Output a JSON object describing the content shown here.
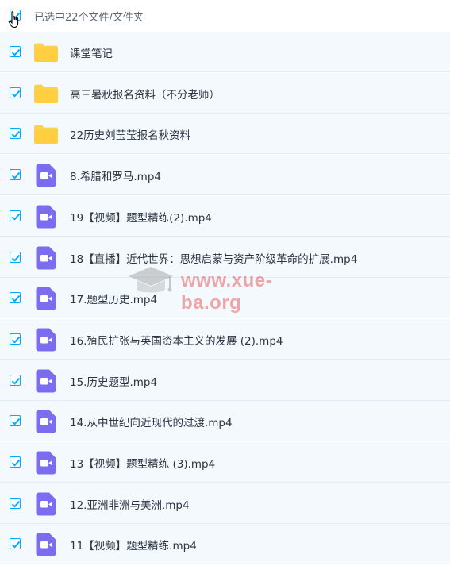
{
  "header": {
    "selection_text": "已选中22个文件/文件夹"
  },
  "files": [
    {
      "name": "课堂笔记",
      "type": "folder"
    },
    {
      "name": "高三暑秋报名资料（不分老师）",
      "type": "folder"
    },
    {
      "name": "22历史刘莹莹报名秋资料",
      "type": "folder"
    },
    {
      "name": "8.希腊和罗马.mp4",
      "type": "video"
    },
    {
      "name": "19【视频】题型精练(2).mp4",
      "type": "video"
    },
    {
      "name": "18【直播】近代世界：思想启蒙与资产阶级革命的扩展.mp4",
      "type": "video"
    },
    {
      "name": "17.题型历史.mp4",
      "type": "video"
    },
    {
      "name": "16.殖民扩张与英国资本主义的发展 (2).mp4",
      "type": "video"
    },
    {
      "name": "15.历史题型.mp4",
      "type": "video"
    },
    {
      "name": "14.从中世纪向近现代的过渡.mp4",
      "type": "video"
    },
    {
      "name": "13【视频】题型精练 (3).mp4",
      "type": "video"
    },
    {
      "name": "12.亚洲非洲与美洲.mp4",
      "type": "video"
    },
    {
      "name": "11【视频】题型精练.mp4",
      "type": "video"
    }
  ],
  "watermark": {
    "text": "www.xue-ba.org"
  },
  "icons": {
    "checkbox": "checkbox-checked-icon",
    "folder": "folder-icon",
    "video": "video-file-icon",
    "cursor": "hand-cursor-icon"
  },
  "colors": {
    "accent": "#06a7ff",
    "folder": "#ffd24d",
    "video": "#7b6cf0",
    "row_bg": "#f4f9fe",
    "text": "#2c3440",
    "watermark": "#e44040"
  }
}
